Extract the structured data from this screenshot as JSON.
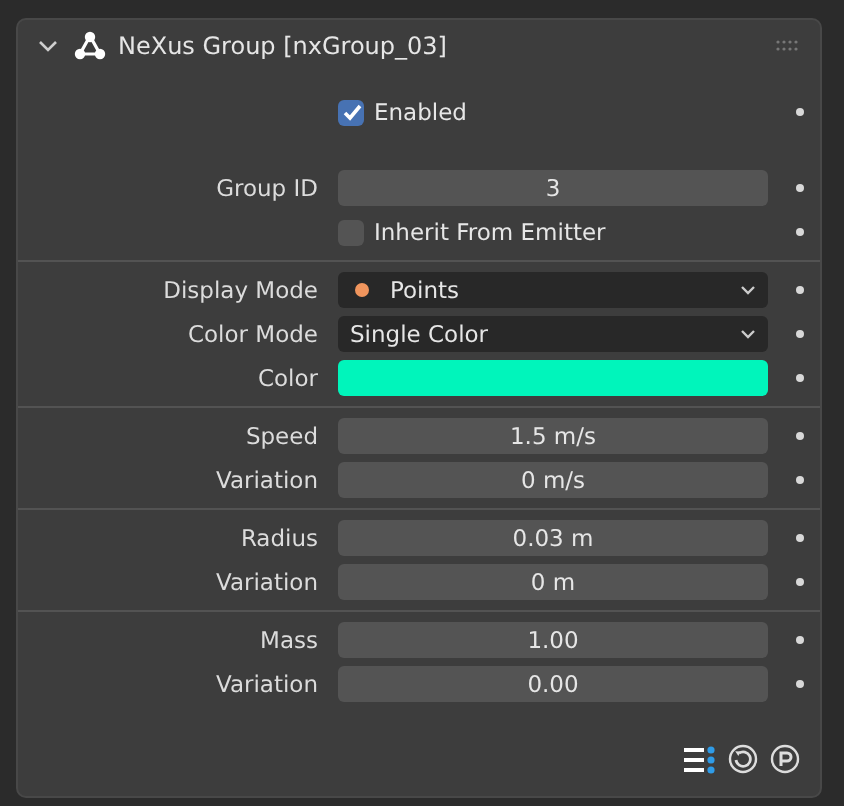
{
  "panel": {
    "title": "NeXus Group [nxGroup_03]",
    "expanded": true
  },
  "sections": [
    {
      "rows": [
        {
          "kind": "checkbox",
          "label": "Enabled",
          "checked": true
        }
      ]
    },
    {
      "rows": [
        {
          "kind": "number",
          "label": "Group ID",
          "value": "3"
        },
        {
          "kind": "checkbox",
          "label": "Inherit From Emitter",
          "checked": false
        }
      ]
    },
    {
      "rows": [
        {
          "kind": "icon-dropdown",
          "label": "Display Mode",
          "value": "Points"
        },
        {
          "kind": "dropdown",
          "label": "Color Mode",
          "value": "Single Color"
        },
        {
          "kind": "color",
          "label": "Color",
          "color": "#00f5bb"
        }
      ]
    },
    {
      "rows": [
        {
          "kind": "number",
          "label": "Speed",
          "value": "1.5 m/s"
        },
        {
          "kind": "number",
          "label": "Variation",
          "value": "0 m/s"
        }
      ]
    },
    {
      "rows": [
        {
          "kind": "number",
          "label": "Radius",
          "value": "0.03 m"
        },
        {
          "kind": "number",
          "label": "Variation",
          "value": "0 m"
        }
      ]
    },
    {
      "rows": [
        {
          "kind": "number",
          "label": "Mass",
          "value": "1.00"
        },
        {
          "kind": "number",
          "label": "Variation",
          "value": "0.00"
        }
      ]
    }
  ]
}
